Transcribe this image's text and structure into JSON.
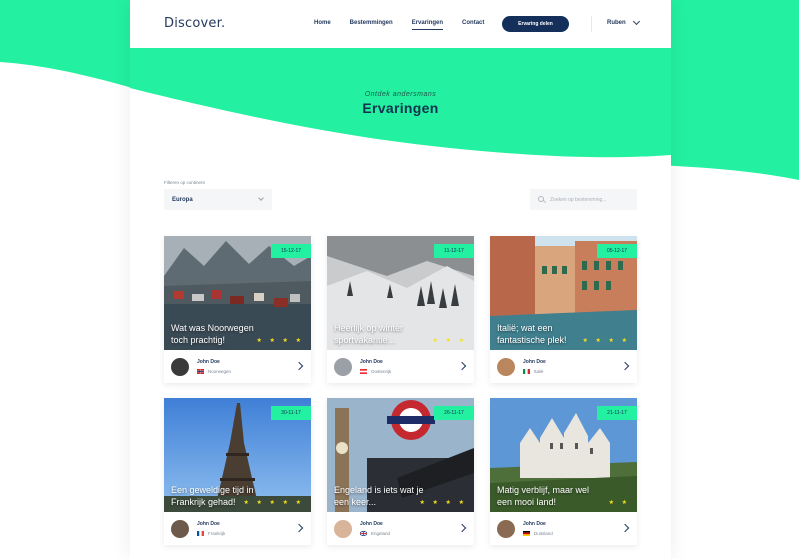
{
  "brand": {
    "logo": "Discover."
  },
  "nav": {
    "items": [
      {
        "label": "Home"
      },
      {
        "label": "Bestemmingen"
      },
      {
        "label": "Ervaringen",
        "active": true
      },
      {
        "label": "Contact"
      }
    ],
    "cta": "Ervaring delen",
    "user": "Ruben"
  },
  "hero": {
    "subtitle": "Ontdek andersmans",
    "title": "Ervaringen"
  },
  "filters": {
    "label": "Filteren op continent",
    "selected": "Europa",
    "search_placeholder": "Zoeken op bestemming..."
  },
  "colors": {
    "accent": "#23f0a0",
    "navy": "#14305a",
    "star": "#f8e11a"
  },
  "cards": [
    {
      "date": "15-12-17",
      "title": "Wat was Noorwegen toch prachtig!",
      "stars": "★ ★ ★ ★",
      "author": "John Doe",
      "country": "Noorwegen",
      "flag": "norway",
      "scene": "fjord"
    },
    {
      "date": "11-12-17",
      "title": "Heerlijk op winter sportvakantie...",
      "stars": "★ ★ ★",
      "author": "John Doe",
      "country": "Oostenrijk",
      "flag": "austria",
      "scene": "snow"
    },
    {
      "date": "05-12-17",
      "title": "Italië; wat een fantastische plek!",
      "stars": "★ ★ ★ ★",
      "author": "John Doe",
      "country": "Italië",
      "flag": "italy",
      "scene": "venice"
    },
    {
      "date": "30-11-17",
      "title": "Een geweldige tijd in Frankrijk gehad!",
      "stars": "★ ★ ★ ★ ★",
      "author": "John Doe",
      "country": "Frankrijk",
      "flag": "france",
      "scene": "paris"
    },
    {
      "date": "26-11-17",
      "title": "Engeland is iets wat je een keer...",
      "stars": "★ ★ ★ ★",
      "author": "John Doe",
      "country": "Engeland",
      "flag": "uk",
      "scene": "london"
    },
    {
      "date": "21-11-17",
      "title": "Matig verblijf, maar wel een mooi land!",
      "stars": "★ ★",
      "author": "John Doe",
      "country": "Duitsland",
      "flag": "germany",
      "scene": "castle"
    }
  ]
}
